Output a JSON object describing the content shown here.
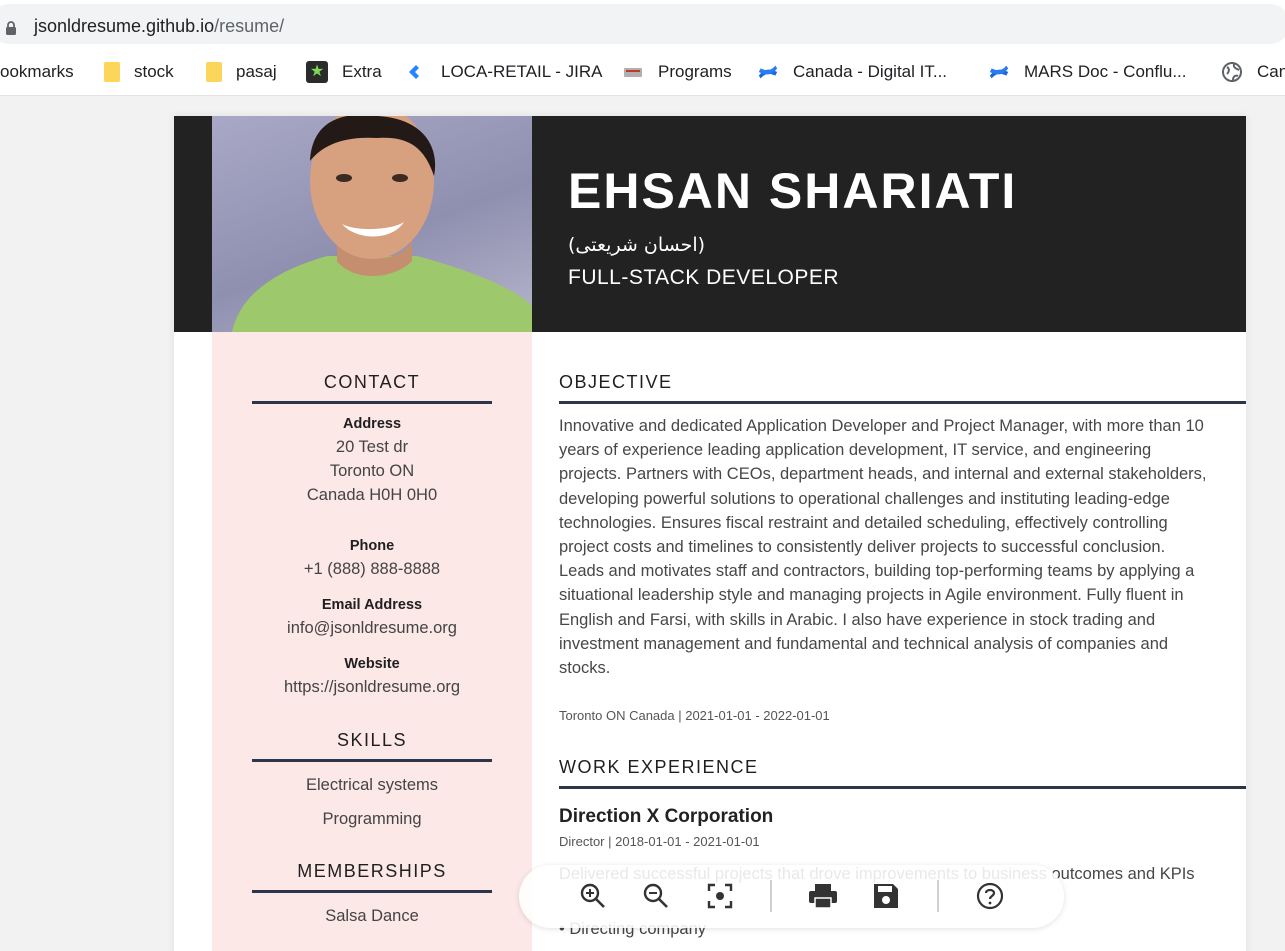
{
  "browser": {
    "url_host": "jsonldresume.github.io",
    "url_path": "/resume/",
    "bookmarks": [
      {
        "label": "ookmarks",
        "icon": "none"
      },
      {
        "label": "stock",
        "icon": "folder-icon"
      },
      {
        "label": "pasaj",
        "icon": "folder-icon"
      },
      {
        "label": "Extra",
        "icon": "star-icon"
      },
      {
        "label": "LOCA-RETAIL - JIRA",
        "icon": "jira-icon"
      },
      {
        "label": "Programs",
        "icon": "programs-icon"
      },
      {
        "label": "Canada - Digital IT...",
        "icon": "confluence-icon"
      },
      {
        "label": "MARS Doc - Conflu...",
        "icon": "confluence-icon"
      },
      {
        "label": "Can",
        "icon": "globe-icon"
      }
    ]
  },
  "resume": {
    "name": "EHSAN SHARIATI",
    "alt_name": "(احسان شریعتی)",
    "job_title": "FULL-STACK DEVELOPER",
    "contact": {
      "heading": "CONTACT",
      "address_label": "Address",
      "address_line1": "20 Test dr",
      "address_line2": "Toronto ON",
      "address_line3": "Canada H0H 0H0",
      "phone_label": "Phone",
      "phone": "+1 (888) 888-8888",
      "email_label": "Email Address",
      "email": "info@jsonldresume.org",
      "website_label": "Website",
      "website": "https://jsonldresume.org"
    },
    "skills": {
      "heading": "SKILLS",
      "items": [
        "Electrical systems",
        "Programming"
      ]
    },
    "memberships": {
      "heading": "MEMBERSHIPS",
      "items": [
        "Salsa Dance"
      ]
    },
    "objective": {
      "heading": "OBJECTIVE",
      "text": "Innovative and dedicated Application Developer and Project Manager, with more than 10 years of experience leading application development, IT service, and engineering projects. Partners with CEOs, department heads, and internal and external stakeholders, developing powerful solutions to operational challenges and instituting leading-edge technologies. Ensures fiscal restraint and detailed scheduling, effectively controlling project costs and timelines to consistently deliver projects to successful conclusion. Leads and motivates staff and contractors, building top-performing teams by applying a situational leadership style and managing projects in Agile environment. Fully fluent in English and Farsi, with skills in Arabic. I also have experience in stock trading and investment management and fundamental and technical analysis of companies and stocks.",
      "meta": "Toronto ON Canada | 2021-01-01 - 2022-01-01"
    },
    "work": {
      "heading": "WORK EXPERIENCE",
      "org": "Direction X Corporation",
      "meta": "Director | 2018-01-01 - 2021-01-01",
      "description": "Delivered successful projects that drove improvements to business outcomes and KPIs",
      "bullet": "Directing company"
    }
  },
  "toolbar": {
    "buttons": [
      "zoom-in-icon",
      "zoom-out-icon",
      "fit-screen-icon",
      "print-icon",
      "save-icon",
      "help-icon"
    ]
  }
}
